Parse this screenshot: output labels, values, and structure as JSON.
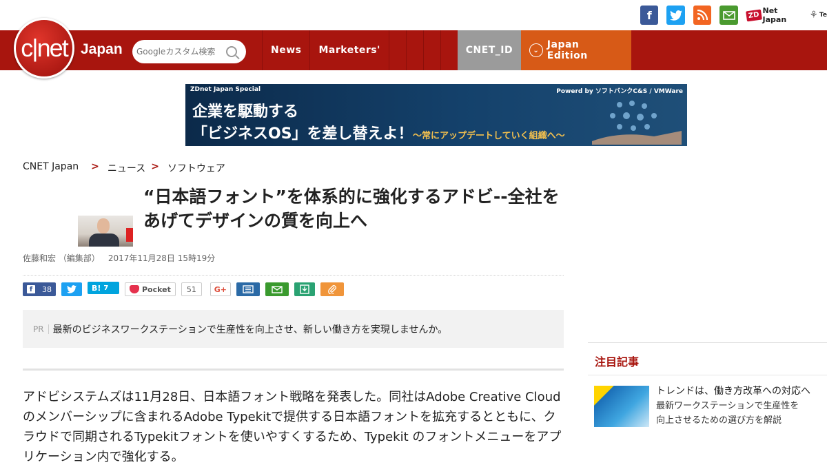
{
  "top_social": {
    "facebook": "f",
    "twitter": "t",
    "rss": "rss",
    "mail": "mail",
    "zdnet_badge": "ZD",
    "zdnet_label": "Net Japan",
    "techrepublic_label": "Te"
  },
  "colors": {
    "brand_red": "#a8150e",
    "facebook": "#3b5998",
    "twitter": "#1da1f2",
    "rss": "#f26522",
    "mail": "#4a9a2f",
    "cnetid": "#9b9b9b",
    "edition": "#d75a17"
  },
  "logo": {
    "mark": "c|net",
    "region": "Japan"
  },
  "search": {
    "placeholder": "Googleカスタム検索"
  },
  "nav": {
    "items": [
      "News",
      "Marketers'"
    ],
    "cnetid": "CNET_ID",
    "edition": "Japan Edition"
  },
  "banner": {
    "tag": "ZDnet Japan Special",
    "powered": "Powerd by ソフトバンクC&S / VMWare",
    "line1": "企業を駆動する",
    "line2": "「ビジネスOS」を差し替えよ！",
    "line3": "〜常にアップデートしていく組織へ〜"
  },
  "breadcrumb": {
    "home": "CNET Japan",
    "section": "ニュース",
    "subsection": "ソフトウェア"
  },
  "article": {
    "title": "“日本語フォント”を体系的に強化するアドビ--全社をあげてデザインの質を向上へ",
    "author": "佐藤和宏 （編集部）",
    "date": "2017年11月28日 15時19分",
    "pr_label": "PR",
    "pr_text": "最新のビジネスワークステーションで生産性を向上させ、新しい働き方を実現しませんか。",
    "body": "アドビシステムズは11月28日、日本語フォント戦略を発表した。同社はAdobe Creative Cloudのメンバーシップに含まれるAdobe Typekitで提供する日本語フォントを拡充するとともに、クラウドで同期されるTypekitフォントを使いやすくするため、Typekit のフォントメニューをアプリケーション内で強化する。"
  },
  "share": {
    "facebook_count": "38",
    "hatena_label": "B!",
    "hatena_count": "7",
    "pocket_label": "Pocket",
    "pocket_count": "51",
    "gplus": "G+"
  },
  "sidebar": {
    "heading": "注目記事",
    "item_title": "トレンドは、働き方改革への対応へ",
    "item_sub1": "最新ワークステーションで生産性を",
    "item_sub2": "向上させるための選び方を解説"
  }
}
